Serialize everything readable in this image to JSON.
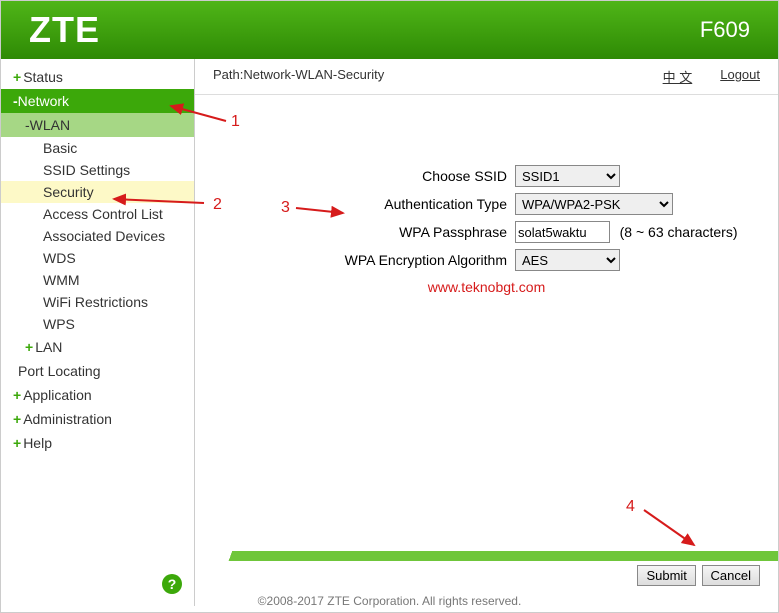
{
  "header": {
    "brand": "ZTE",
    "model": "F609"
  },
  "topbar": {
    "path": "Path:Network-WLAN-Security",
    "lang_link": "中 文",
    "logout_link": "Logout"
  },
  "sidebar": {
    "status": "Status",
    "network": "Network",
    "wlan": "WLAN",
    "leaves": {
      "basic": "Basic",
      "ssid": "SSID Settings",
      "security": "Security",
      "acl": "Access Control List",
      "assoc": "Associated Devices",
      "wds": "WDS",
      "wmm": "WMM",
      "restrict": "WiFi Restrictions",
      "wps": "WPS"
    },
    "lan": "LAN",
    "port": "Port Locating",
    "application": "Application",
    "administration": "Administration",
    "help": "Help"
  },
  "form": {
    "ssid_label": "Choose SSID",
    "ssid_value": "SSID1",
    "auth_label": "Authentication Type",
    "auth_value": "WPA/WPA2-PSK",
    "pass_label": "WPA Passphrase",
    "pass_value": "solat5waktu",
    "pass_hint": "(8 ~ 63 characters)",
    "enc_label": "WPA Encryption Algorithm",
    "enc_value": "AES"
  },
  "watermark": "www.teknobgt.com",
  "buttons": {
    "submit": "Submit",
    "cancel": "Cancel"
  },
  "footer": "©2008-2017 ZTE Corporation. All rights reserved.",
  "annotations": {
    "n1": "1",
    "n2": "2",
    "n3": "3",
    "n4": "4"
  }
}
